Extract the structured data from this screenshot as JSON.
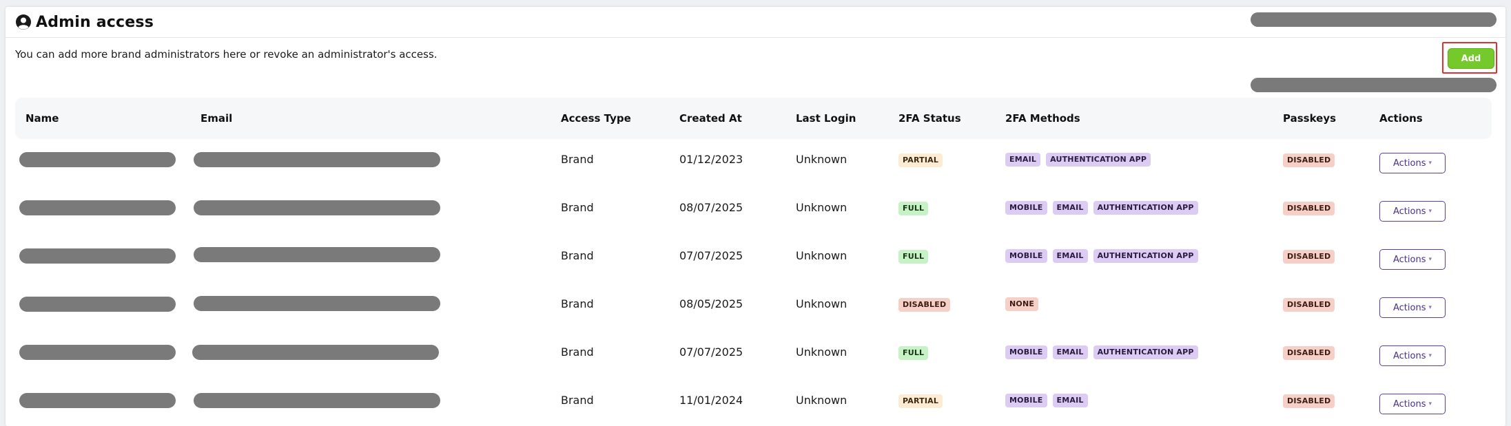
{
  "header": {
    "title": "Admin access",
    "title_icon": "user-circle-icon"
  },
  "description": "You can add more brand administrators here or revoke an administrator's access.",
  "add_button_label": "Add",
  "colors": {
    "add_button": "#75c92b",
    "highlight_outline": "#e0312f",
    "actions_button_border": "#5b3fa0"
  },
  "table": {
    "columns": [
      "Name",
      "Email",
      "Access Type",
      "Created At",
      "Last Login",
      "2FA Status",
      "2FA Methods",
      "Passkeys",
      "Actions"
    ],
    "rows": [
      {
        "access_type": "Brand",
        "created_at": "01/12/2023",
        "last_login": "Unknown",
        "status_2fa": "PARTIAL",
        "methods": [
          "EMAIL",
          "AUTHENTICATION APP"
        ],
        "passkeys": "DISABLED",
        "actions": "Actions"
      },
      {
        "access_type": "Brand",
        "created_at": "08/07/2025",
        "last_login": "Unknown",
        "status_2fa": "FULL",
        "methods": [
          "MOBILE",
          "EMAIL",
          "AUTHENTICATION APP"
        ],
        "passkeys": "DISABLED",
        "actions": "Actions"
      },
      {
        "access_type": "Brand",
        "created_at": "07/07/2025",
        "last_login": "Unknown",
        "status_2fa": "FULL",
        "methods": [
          "MOBILE",
          "EMAIL",
          "AUTHENTICATION APP"
        ],
        "passkeys": "DISABLED",
        "actions": "Actions"
      },
      {
        "access_type": "Brand",
        "created_at": "08/05/2025",
        "last_login": "Unknown",
        "status_2fa": "DISABLED",
        "methods": [
          "NONE"
        ],
        "passkeys": "DISABLED",
        "actions": "Actions"
      },
      {
        "access_type": "Brand",
        "created_at": "07/07/2025",
        "last_login": "Unknown",
        "status_2fa": "FULL",
        "methods": [
          "MOBILE",
          "EMAIL",
          "AUTHENTICATION APP"
        ],
        "passkeys": "DISABLED",
        "actions": "Actions"
      },
      {
        "access_type": "Brand",
        "created_at": "11/01/2024",
        "last_login": "Unknown",
        "status_2fa": "PARTIAL",
        "methods": [
          "MOBILE",
          "EMAIL"
        ],
        "passkeys": "DISABLED",
        "actions": "Actions"
      }
    ]
  }
}
